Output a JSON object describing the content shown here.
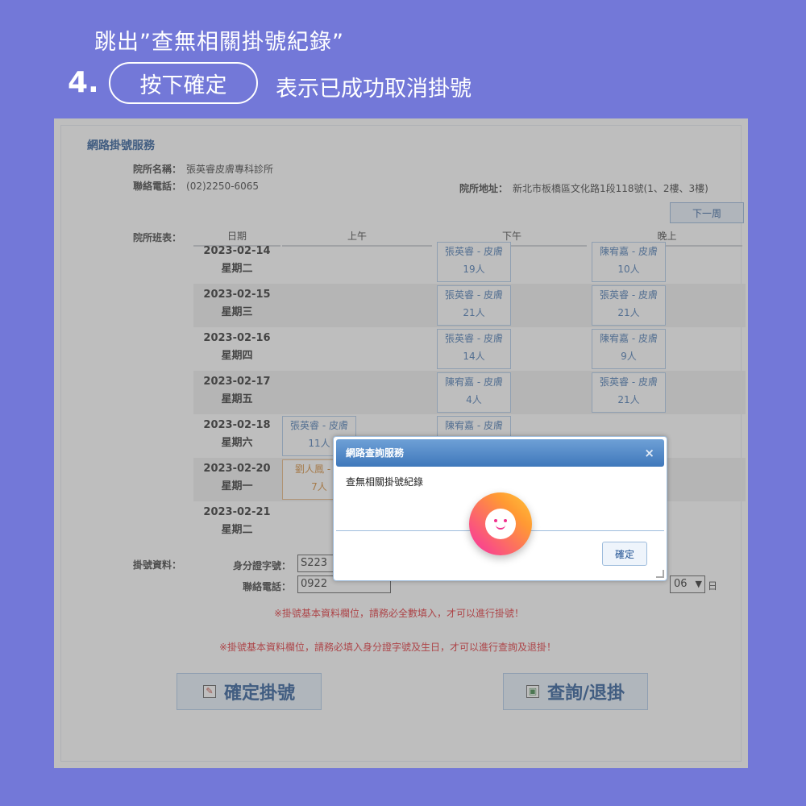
{
  "caption": {
    "line1": "跳出”查無相關掛號紀錄”",
    "step_number": "4.",
    "step_action": "按下確定",
    "step_result": "表示已成功取消掛號"
  },
  "page": {
    "title": "網路掛號服務",
    "clinic_name_label": "院所名稱：",
    "clinic_name": "張英睿皮膚專科診所",
    "phone_label": "聯絡電話：",
    "phone": "(02)2250-6065",
    "address_label": "院所地址：",
    "address": "新北市板橋區文化路1段118號(1、2樓、3樓)",
    "next_week_button": "下一周",
    "schedule_label": "院所班表：",
    "columns": [
      "日期",
      "上午",
      "下午",
      "晚上"
    ]
  },
  "schedule": [
    {
      "date": "2023-02-14",
      "weekday": "星期二",
      "am": null,
      "pm": {
        "doctor": "張英睿 - 皮膚",
        "count": "19人"
      },
      "eve": {
        "doctor": "陳宥嘉 - 皮膚",
        "count": "10人"
      }
    },
    {
      "date": "2023-02-15",
      "weekday": "星期三",
      "am": null,
      "pm": {
        "doctor": "張英睿 - 皮膚",
        "count": "21人"
      },
      "eve": {
        "doctor": "張英睿 - 皮膚",
        "count": "21人"
      }
    },
    {
      "date": "2023-02-16",
      "weekday": "星期四",
      "am": null,
      "pm": {
        "doctor": "張英睿 - 皮膚",
        "count": "14人"
      },
      "eve": {
        "doctor": "陳宥嘉 - 皮膚",
        "count": "9人"
      }
    },
    {
      "date": "2023-02-17",
      "weekday": "星期五",
      "am": null,
      "pm": {
        "doctor": "陳宥嘉 - 皮膚",
        "count": "4人"
      },
      "eve": {
        "doctor": "張英睿 - 皮膚",
        "count": "21人"
      }
    },
    {
      "date": "2023-02-18",
      "weekday": "星期六",
      "am": {
        "doctor": "張英睿 - 皮膚",
        "count": "11人"
      },
      "pm": {
        "doctor": "陳宥嘉 - 皮膚",
        "count": ""
      },
      "eve": null
    },
    {
      "date": "2023-02-20",
      "weekday": "星期一",
      "am": {
        "doctor": "劉人鳳 - 皮",
        "count": "7人"
      },
      "pm": null,
      "eve": null
    },
    {
      "date": "2023-02-21",
      "weekday": "星期二",
      "am": null,
      "pm": null,
      "eve": null
    }
  ],
  "registration": {
    "label": "掛號資料：",
    "id_label": "身分證字號：",
    "id_value": "S223",
    "phone_label": "聯絡電話：",
    "phone_value": "0922",
    "day_value": "06",
    "day_suffix": "日",
    "notice1": "※掛號基本資料欄位，請務必全數填入，才可以進行掛號！",
    "notice2": "※掛號基本資料欄位，請務必填入身分證字號及生日，才可以進行查詢及退掛！",
    "confirm_button": "確定掛號",
    "query_button": "查詢/退掛"
  },
  "dialog": {
    "title": "網路查詢服務",
    "close": "×",
    "message": "查無相關掛號紀錄",
    "ok_button": "確定"
  },
  "colors": {
    "background": "#7378d8",
    "link_blue": "#1d4f91",
    "notice_red": "#e0242a"
  }
}
